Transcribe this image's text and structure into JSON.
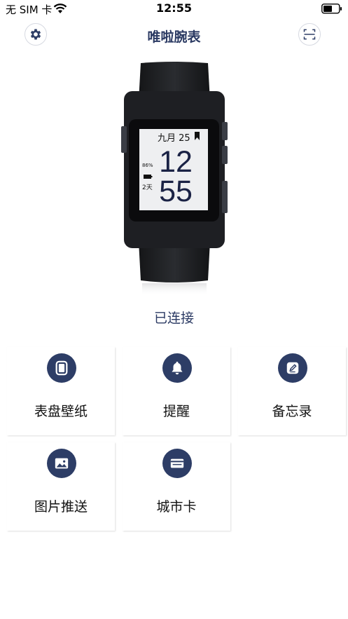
{
  "status_bar": {
    "carrier": "无 SIM 卡",
    "time": "12:55"
  },
  "nav": {
    "title": "唯啦腕表",
    "left_icon": "gear-icon",
    "right_icon": "scan-icon"
  },
  "watch": {
    "date": "九月 25",
    "hour": "12",
    "minute": "55",
    "battery_pct": "86%",
    "days": "2天"
  },
  "connection_status": "已连接",
  "features": [
    {
      "label": "表盘壁纸",
      "icon": "watch-face-icon"
    },
    {
      "label": "提醒",
      "icon": "bell-icon"
    },
    {
      "label": "备忘录",
      "icon": "memo-edit-icon"
    },
    {
      "label": "图片推送",
      "icon": "image-icon"
    },
    {
      "label": "城市卡",
      "icon": "card-icon"
    }
  ],
  "colors": {
    "accent": "#2d3d66",
    "title": "#2b3a63"
  }
}
